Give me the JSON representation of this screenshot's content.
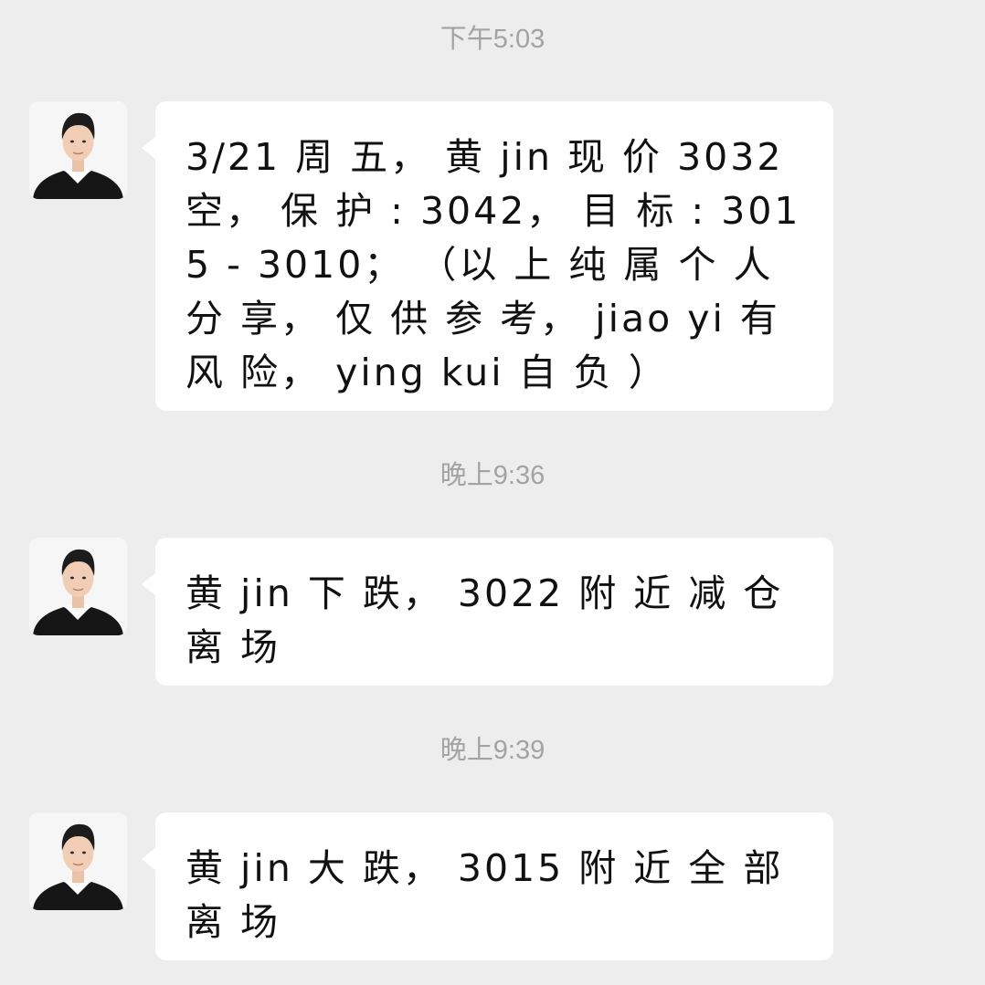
{
  "chat": {
    "messages": [
      {
        "time": "下午5:03",
        "avatar_icon": "user-avatar-icon",
        "text": "3/21 周 五， 黄 jin 现 价 3032 空， 保 护 : 3042， 目 标 : 3015 - 3010； （以 上 纯 属 个 人 分 享， 仅 供 参 考， jiao yi 有 风 险， ying kui 自 负 ）"
      },
      {
        "time": "晚上9:36",
        "avatar_icon": "user-avatar-icon",
        "text": "黄 jin 下 跌， 3022 附 近 减 仓 离 场"
      },
      {
        "time": "晚上9:39",
        "avatar_icon": "user-avatar-icon",
        "text": "黄 jin 大 跌， 3015 附 近 全 部 离 场"
      }
    ]
  },
  "colors": {
    "background": "#ededed",
    "bubble": "#ffffff",
    "timestamp": "#a3a3a3",
    "text": "#111111"
  }
}
